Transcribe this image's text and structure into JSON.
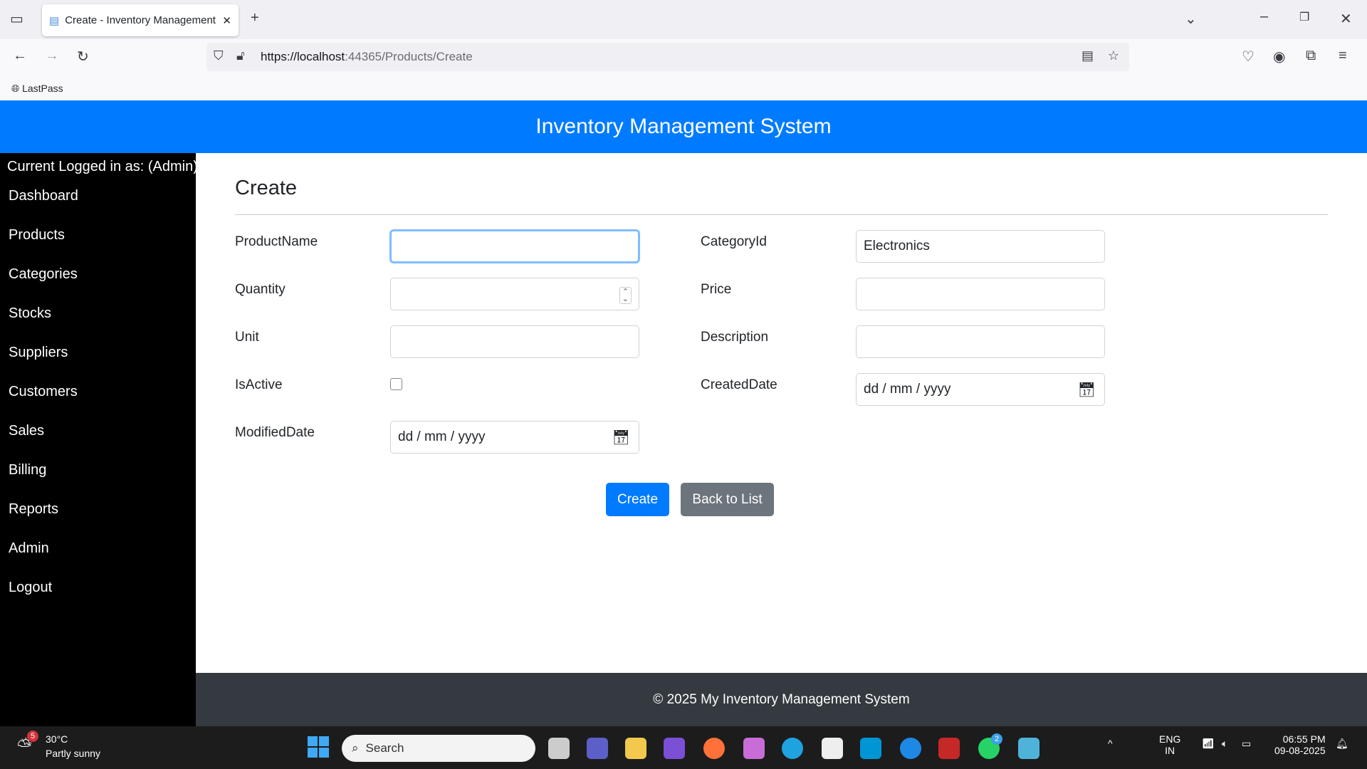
{
  "browser": {
    "tab_title": "Create - Inventory Management",
    "url_host": "https://localhost",
    "url_rest": ":44365/Products/Create",
    "bookmark": "LastPass"
  },
  "header": {
    "title": "Inventory Management System"
  },
  "sidebar": {
    "current_user": "Current Logged in as: (Admin)",
    "items": [
      "Dashboard",
      "Products",
      "Categories",
      "Stocks",
      "Suppliers",
      "Customers",
      "Sales",
      "Billing",
      "Reports",
      "Admin",
      "Logout"
    ]
  },
  "form": {
    "title": "Create",
    "product_name": {
      "label": "ProductName",
      "value": ""
    },
    "category": {
      "label": "CategoryId",
      "value": "Electronics"
    },
    "quantity": {
      "label": "Quantity",
      "value": ""
    },
    "price": {
      "label": "Price",
      "value": ""
    },
    "unit": {
      "label": "Unit",
      "value": ""
    },
    "description": {
      "label": "Description",
      "value": ""
    },
    "is_active": {
      "label": "IsActive",
      "checked": false
    },
    "created_date": {
      "label": "CreatedDate",
      "placeholder": "dd / mm / yyyy"
    },
    "modified_date": {
      "label": "ModifiedDate",
      "placeholder": "dd / mm / yyyy"
    },
    "create_button": "Create",
    "back_button": "Back to List"
  },
  "footer": {
    "text": "© 2025 My Inventory Management System"
  },
  "taskbar": {
    "weather_temp": "30°C",
    "weather_desc": "Partly sunny",
    "weather_badge": "5",
    "search": "Search",
    "lang1": "ENG",
    "lang2": "IN",
    "time": "06:55 PM",
    "date": "09-08-2025",
    "whatsapp_badge": "2"
  },
  "colors": {
    "primary": "#007bff",
    "secondary": "#6c757d",
    "footer": "#343a40"
  }
}
